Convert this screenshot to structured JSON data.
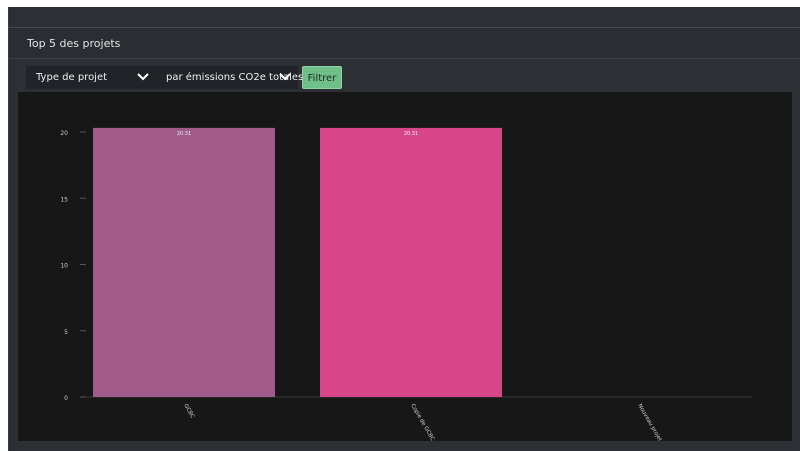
{
  "panel": {
    "title": "Top 5 des projets"
  },
  "filters": {
    "group_select": "Type de projet",
    "metric_select": "par émissions CO2e totales",
    "filter_button": "Filtrer"
  },
  "colors": {
    "bar_1": "#a05b8a",
    "bar_2": "#d7458a",
    "chart_background": "#171717",
    "filter_button": "#6fbf8b"
  },
  "chart_data": {
    "type": "bar",
    "categories": [
      "GCBC",
      "Copie de GCBC",
      "Nouveau projet Bâtiment"
    ],
    "values": [
      20.31,
      20.31,
      0
    ],
    "data_labels": [
      "20.31",
      "20.31",
      ""
    ],
    "yticks": [
      "0",
      "5",
      "10",
      "15",
      "20"
    ],
    "ylim": [
      0,
      21
    ],
    "title": "",
    "xlabel": "",
    "ylabel": "",
    "grid": false
  }
}
